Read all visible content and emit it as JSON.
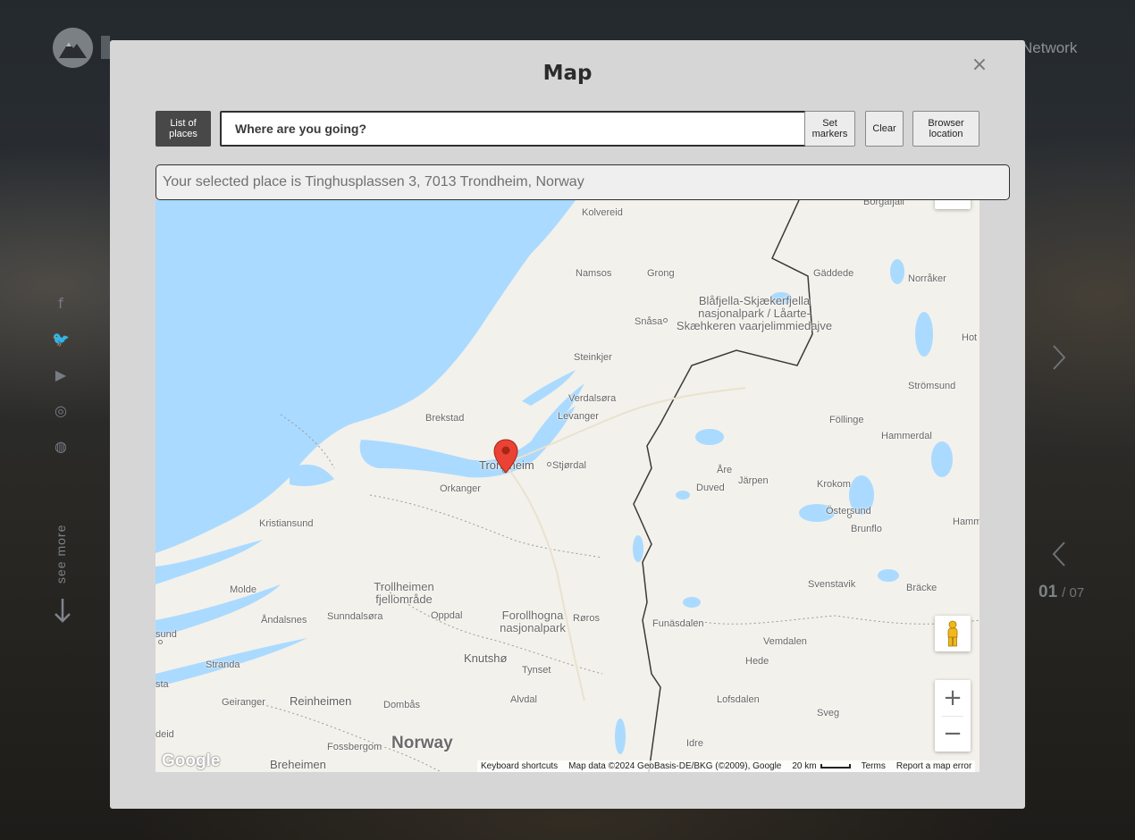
{
  "background": {
    "nav_network": "Network",
    "social": {
      "facebook": "f",
      "twitter": "🐦",
      "youtube": "▶",
      "instagram": "◎",
      "dribbble": "◍"
    },
    "see_more": "see more",
    "slide_current": "01",
    "slide_total": "/ 07"
  },
  "modal": {
    "title": "Map",
    "close_label": "×",
    "list_button": "List of places",
    "search": {
      "placeholder": "Where are you going?",
      "value": ""
    },
    "set_markers_button": "Set markers",
    "clear_button": "Clear",
    "browser_location_button": "Browser location",
    "selected_place": "Your selected place is Tinghusplassen 3, 7013 Trondheim, Norway"
  },
  "map": {
    "labels": {
      "kolvereid": "Kolvereid",
      "borgafjall": "Borgafjäll",
      "namsos": "Namsos",
      "grong": "Grong",
      "gaddede": "Gäddede",
      "norraker": "Norråker",
      "snasa": "Snåsa",
      "park1": "Blåfjella-Skjækerfjella nasjonalpark / Låarte-Skæhkeren vaarjelimmiedajve",
      "steinkjer": "Steinkjer",
      "hot": "Hot",
      "stromsund": "Strömsund",
      "verdalsora": "Verdalsøra",
      "levanger": "Levanger",
      "brekstad": "Brekstad",
      "follinge": "Föllinge",
      "hammerdal": "Hammerdal",
      "trondheim": "Trondheim",
      "stjordal": "Stjørdal",
      "are": "Åre",
      "jarpen": "Järpen",
      "duved": "Duved",
      "krokom": "Krokom",
      "orkanger": "Orkanger",
      "ostersund": "Östersund",
      "brunflo": "Brunflo",
      "hamm": "Hamm",
      "kristiansund": "Kristiansund",
      "molde": "Molde",
      "trollheimen": "Trollheimen fjellområde",
      "svenstavik": "Svenstavik",
      "bracke": "Bräcke",
      "andalsnes": "Åndalsnes",
      "sunndalsora": "Sunndalsøra",
      "oppdal": "Oppdal",
      "forollhogna": "Forollhogna nasjonalpark",
      "roros": "Røros",
      "funasdalen": "Funäsdalen",
      "vemdalen": "Vemdalen",
      "hede": "Hede",
      "sund": "sund",
      "stranda": "Stranda",
      "kvitsoy": "Knutshø",
      "tynset": "Tynset",
      "sta": "sta",
      "geiranger": "Geiranger",
      "reinheimen": "Reinheimen",
      "dombas": "Dombås",
      "alvdal": "Alvdal",
      "lofsdalen": "Lofsdalen",
      "sveg": "Sveg",
      "eid": "deid",
      "fossbergom": "Fossbergom",
      "norway": "Norway",
      "idre": "Idre",
      "breheimen": "Breheimen"
    },
    "google": "Google",
    "attribution": {
      "keyboard": "Keyboard shortcuts",
      "data": "Map data ©2024 GeoBasis-DE/BKG (©2009), Google",
      "scale": "20 km",
      "terms": "Terms",
      "report": "Report a map error"
    },
    "zoom_in": "+",
    "zoom_out": "−",
    "colors": {
      "water": "#aadaff",
      "land": "#f3f1eb",
      "marker": "#ea4335",
      "border": "#3a3a3a"
    }
  }
}
